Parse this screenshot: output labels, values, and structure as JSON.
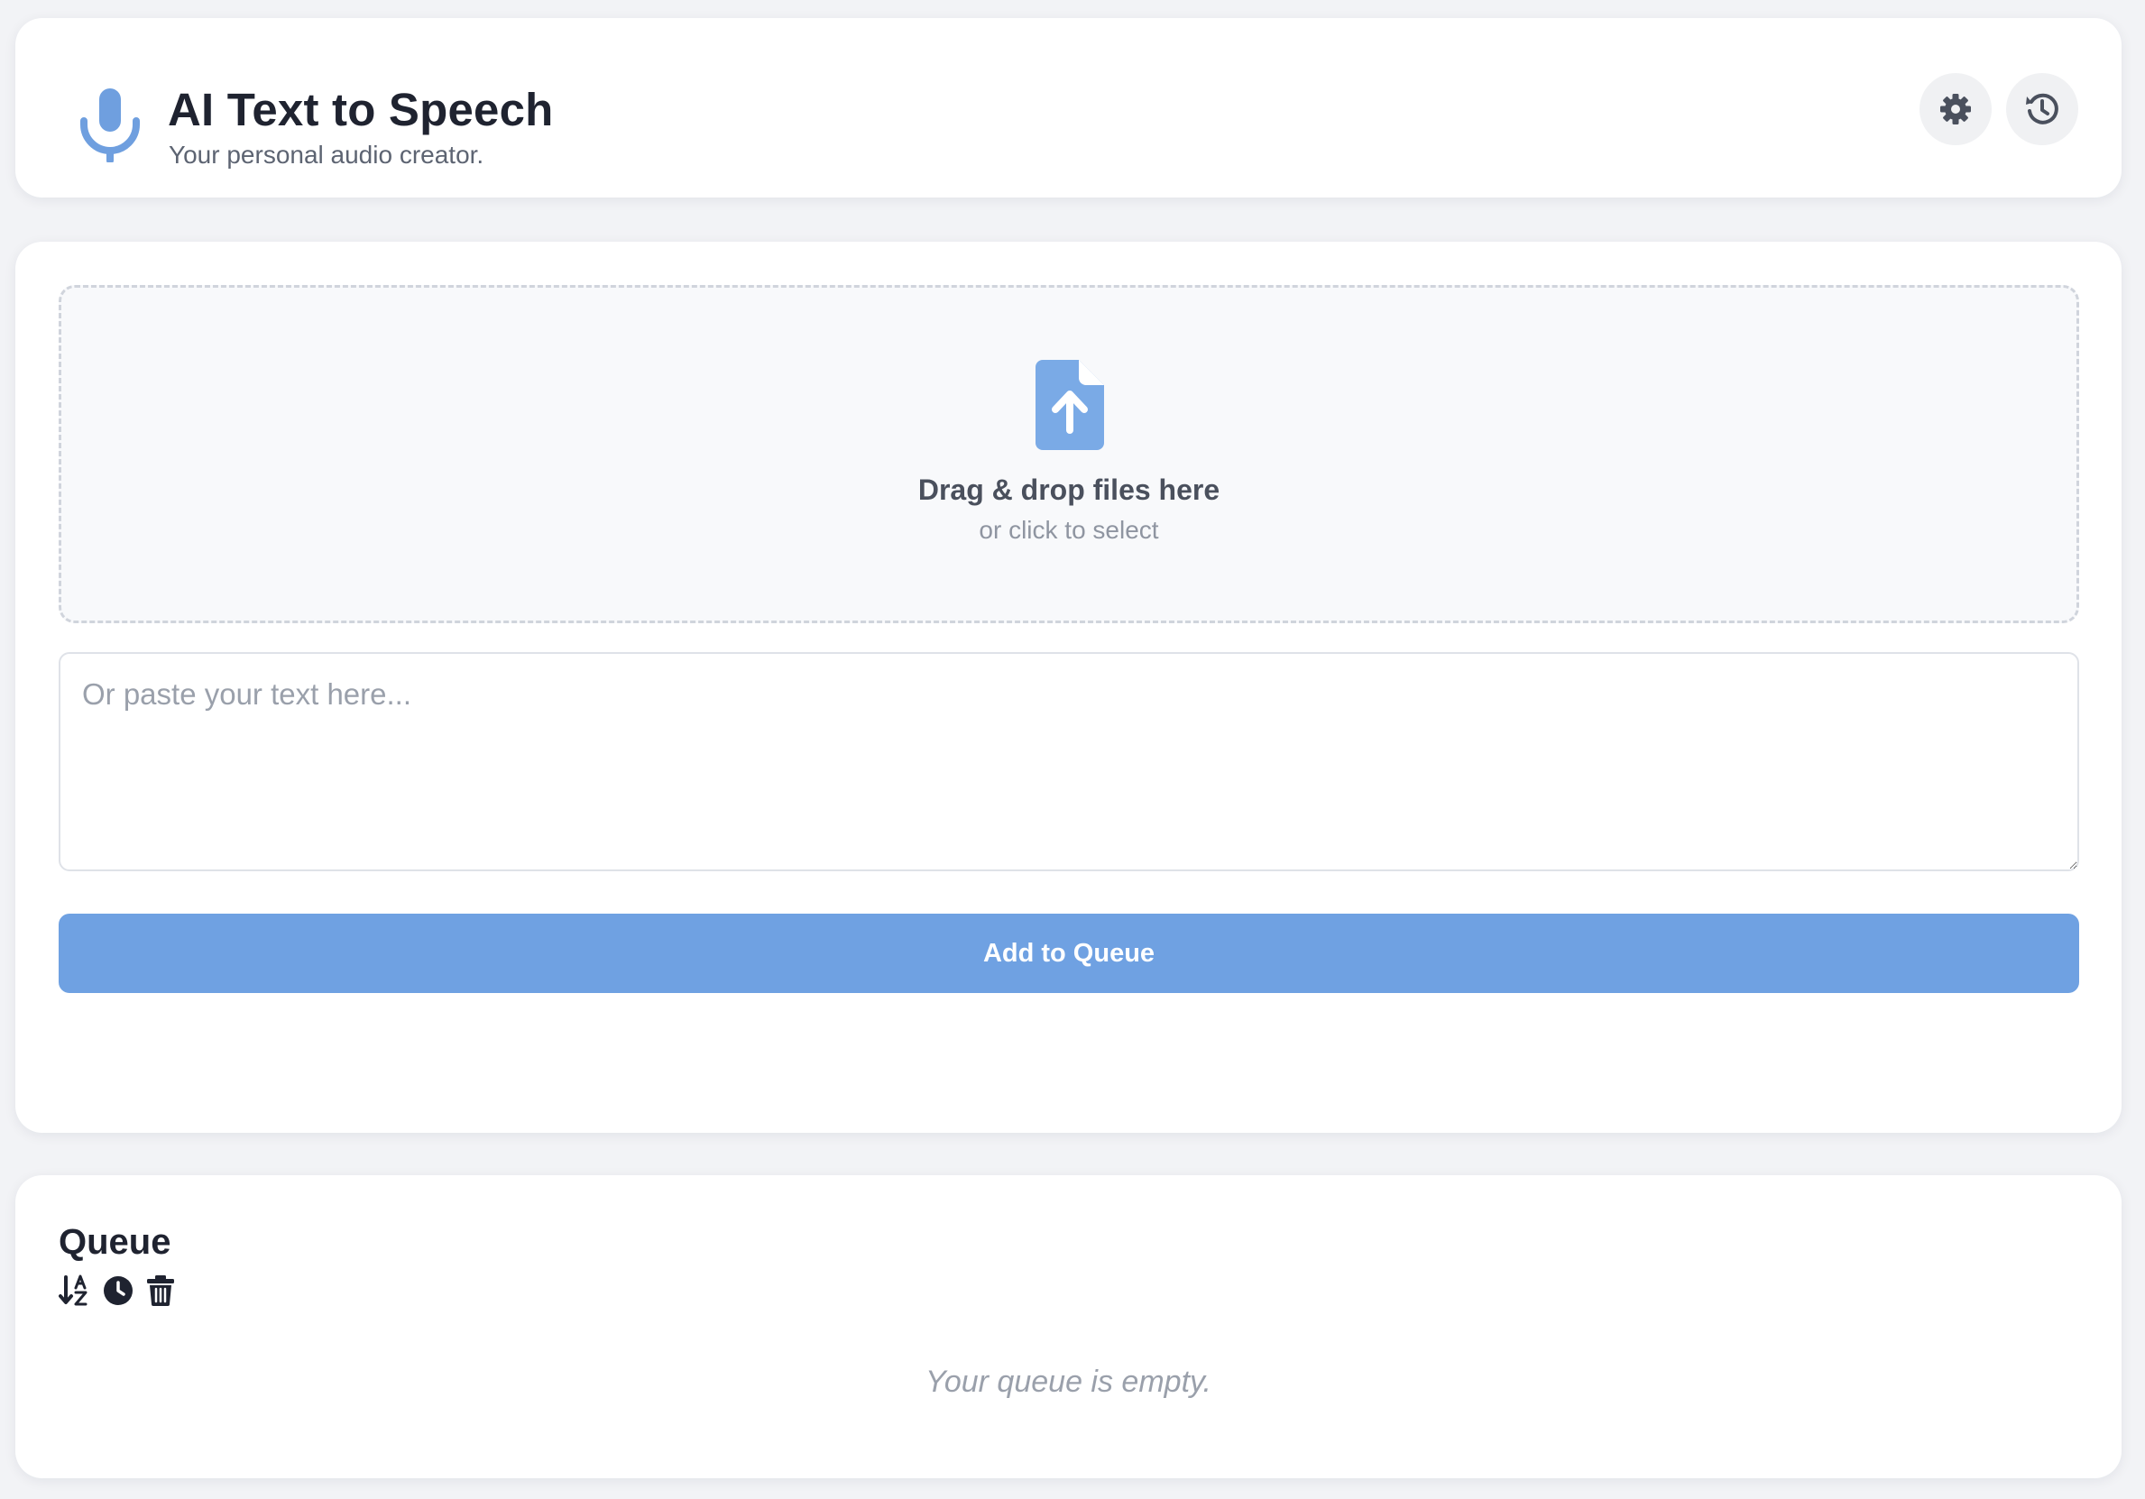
{
  "header": {
    "title": "AI Text to Speech",
    "subtitle": "Your personal audio creator.",
    "icons": [
      "microphone-icon",
      "gear-icon",
      "history-icon"
    ]
  },
  "upload": {
    "dropzone_title": "Drag & drop files here",
    "dropzone_subtitle": "or click to select",
    "icon": "file-upload-icon"
  },
  "text_input": {
    "placeholder": "Or paste your text here...",
    "value": ""
  },
  "actions": {
    "add_label": "Add to Queue"
  },
  "queue": {
    "title": "Queue",
    "icons": [
      "sort-alpha-icon",
      "clock-icon",
      "trash-icon"
    ],
    "empty_message": "Your queue is empty."
  },
  "colors": {
    "accent": "#6fa1e2",
    "background": "#f2f3f6",
    "card": "#ffffff",
    "text": "#1f2330",
    "muted": "#5d6472"
  }
}
